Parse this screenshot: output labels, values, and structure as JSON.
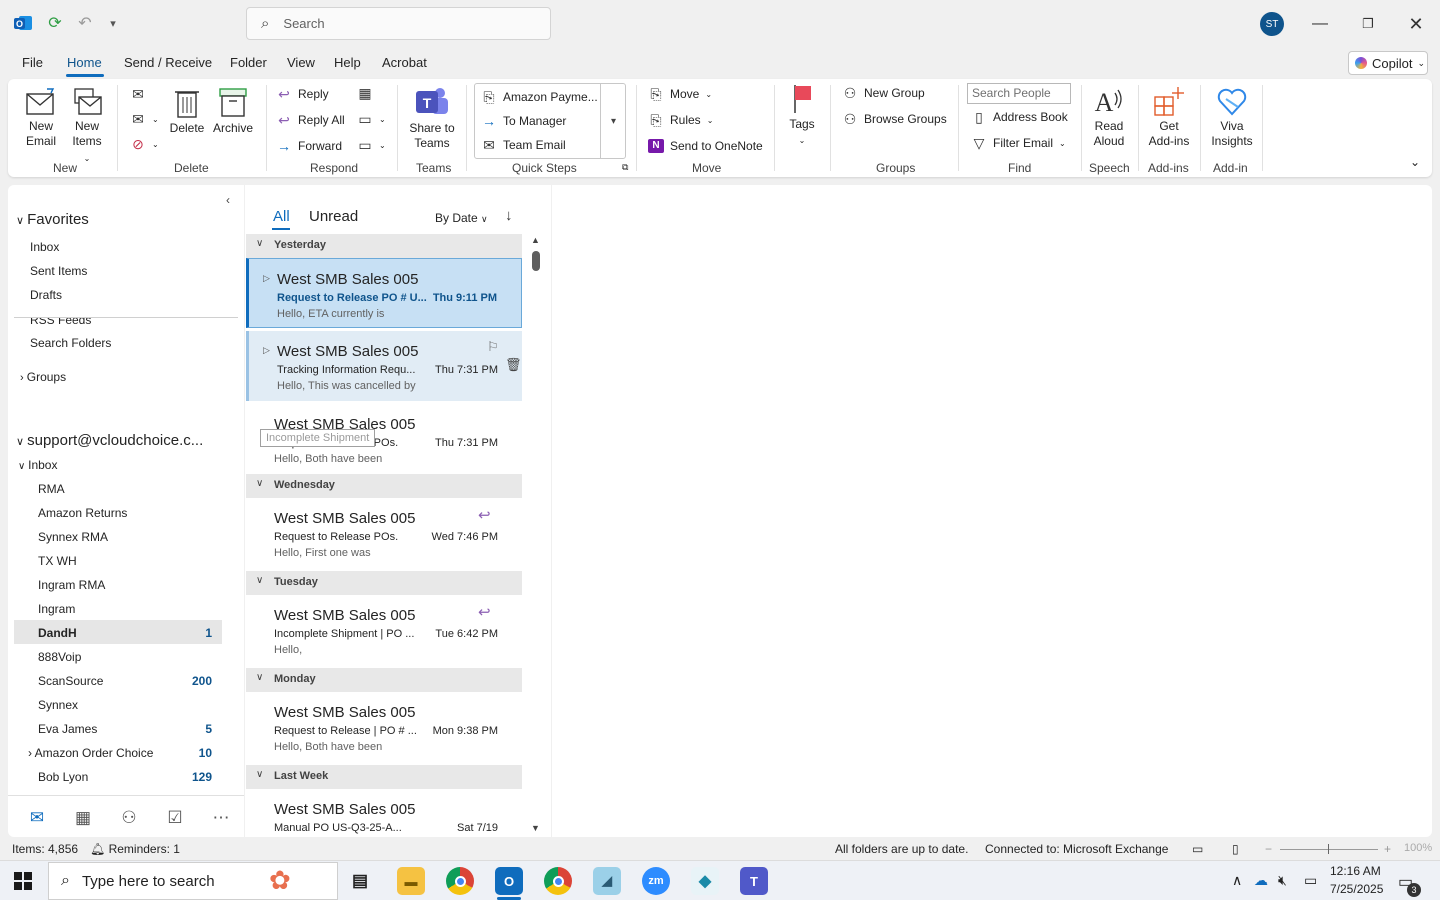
{
  "titlebar": {
    "search_placeholder": "Search",
    "avatar_initials": "ST"
  },
  "menu": {
    "items": [
      "File",
      "Home",
      "Send / Receive",
      "Folder",
      "View",
      "Help",
      "Acrobat"
    ],
    "active": "Home",
    "copilot_label": "Copilot"
  },
  "ribbon": {
    "new_email": [
      "New",
      "Email"
    ],
    "new_items": [
      "New",
      "Items"
    ],
    "delete_label": "Delete",
    "archive_label": "Archive",
    "reply": "Reply",
    "reply_all": "Reply All",
    "forward": "Forward",
    "share_teams": [
      "Share to",
      "Teams"
    ],
    "quick_steps": [
      "Amazon Payme...",
      "To Manager",
      "Team Email"
    ],
    "move": "Move",
    "rules": "Rules",
    "send_onenote": "Send to OneNote",
    "tags": "Tags",
    "new_group": "New Group",
    "browse_groups": "Browse Groups",
    "search_people_placeholder": "Search People",
    "address_book": "Address Book",
    "filter_email": "Filter Email",
    "read_aloud": [
      "Read",
      "Aloud"
    ],
    "get_addins": [
      "Get",
      "Add-ins"
    ],
    "viva": [
      "Viva",
      "Insights"
    ],
    "groups": [
      "New",
      "Delete",
      "Respond",
      "Teams",
      "Quick Steps",
      "Move",
      "Groups",
      "Find",
      "Speech",
      "Add-ins",
      "Add-in"
    ]
  },
  "folders": {
    "favorites_label": "Favorites",
    "favorites": [
      "Inbox",
      "Sent Items",
      "Drafts"
    ],
    "rss_partial": "RSS Feeds",
    "search_folders": "Search Folders",
    "groups_label": "Groups",
    "account": "support@vcloudchoice.c...",
    "inbox_label": "Inbox",
    "subfolders": [
      {
        "name": "RMA",
        "count": ""
      },
      {
        "name": "Amazon Returns",
        "count": ""
      },
      {
        "name": "Synnex RMA",
        "count": ""
      },
      {
        "name": "TX WH",
        "count": ""
      },
      {
        "name": "Ingram RMA",
        "count": ""
      },
      {
        "name": "Ingram",
        "count": ""
      },
      {
        "name": "DandH",
        "count": "1"
      },
      {
        "name": "888Voip",
        "count": ""
      },
      {
        "name": "ScanSource",
        "count": "200"
      },
      {
        "name": "Synnex",
        "count": ""
      },
      {
        "name": "Eva James",
        "count": "5"
      },
      {
        "name": "Amazon Order Choice",
        "count": "10"
      },
      {
        "name": "Bob Lyon",
        "count": "129"
      }
    ]
  },
  "list": {
    "tab_all": "All",
    "tab_unread": "Unread",
    "sort_label": "By Date",
    "groups": [
      "Yesterday",
      "Wednesday",
      "Tuesday",
      "Monday",
      "Last Week"
    ],
    "messages": [
      {
        "sender": "West SMB Sales 005",
        "subject": "Request to Release PO # U...",
        "time": "Thu 9:11 PM",
        "preview": "Hello,  ETA currently is"
      },
      {
        "sender": "West SMB Sales 005",
        "subject": "Tracking Information Requ...",
        "time": "Thu 7:31 PM",
        "preview": "Hello,  This was cancelled by"
      },
      {
        "sender": "West SMB Sales 005",
        "subject": "Request to Release POs.",
        "time": "Thu 7:31 PM",
        "preview": "Hello,  Both have been"
      },
      {
        "sender": "West SMB Sales 005",
        "subject": "Request to Release POs.",
        "time": "Wed 7:46 PM",
        "preview": "Hello,  First one was"
      },
      {
        "sender": "West SMB Sales 005",
        "subject": "Incomplete Shipment | PO ...",
        "time": "Tue 6:42 PM",
        "preview": "Hello,"
      },
      {
        "sender": "West SMB Sales 005",
        "subject": "Request to Release | PO # ...",
        "time": "Mon 9:38 PM",
        "preview": "Hello,  Both have been"
      },
      {
        "sender": "West SMB Sales 005",
        "subject": "Manual PO     US-Q3-25-A...",
        "time": "Sat 7/19",
        "preview": ""
      }
    ],
    "tooltip": "Incomplete Shipment"
  },
  "status": {
    "items": "Items: 4,856",
    "reminders": "Reminders: 1",
    "sync": "All folders are up to date.",
    "connection": "Connected to: Microsoft Exchange",
    "zoom": "100%"
  },
  "taskbar": {
    "search_placeholder": "Type here to search",
    "time": "12:16 AM",
    "date": "7/25/2025",
    "notifications": "3"
  },
  "colors": {
    "accent": "#0f6cbd",
    "selection": "#c7e0f4",
    "unread_count": "#0f548c"
  }
}
